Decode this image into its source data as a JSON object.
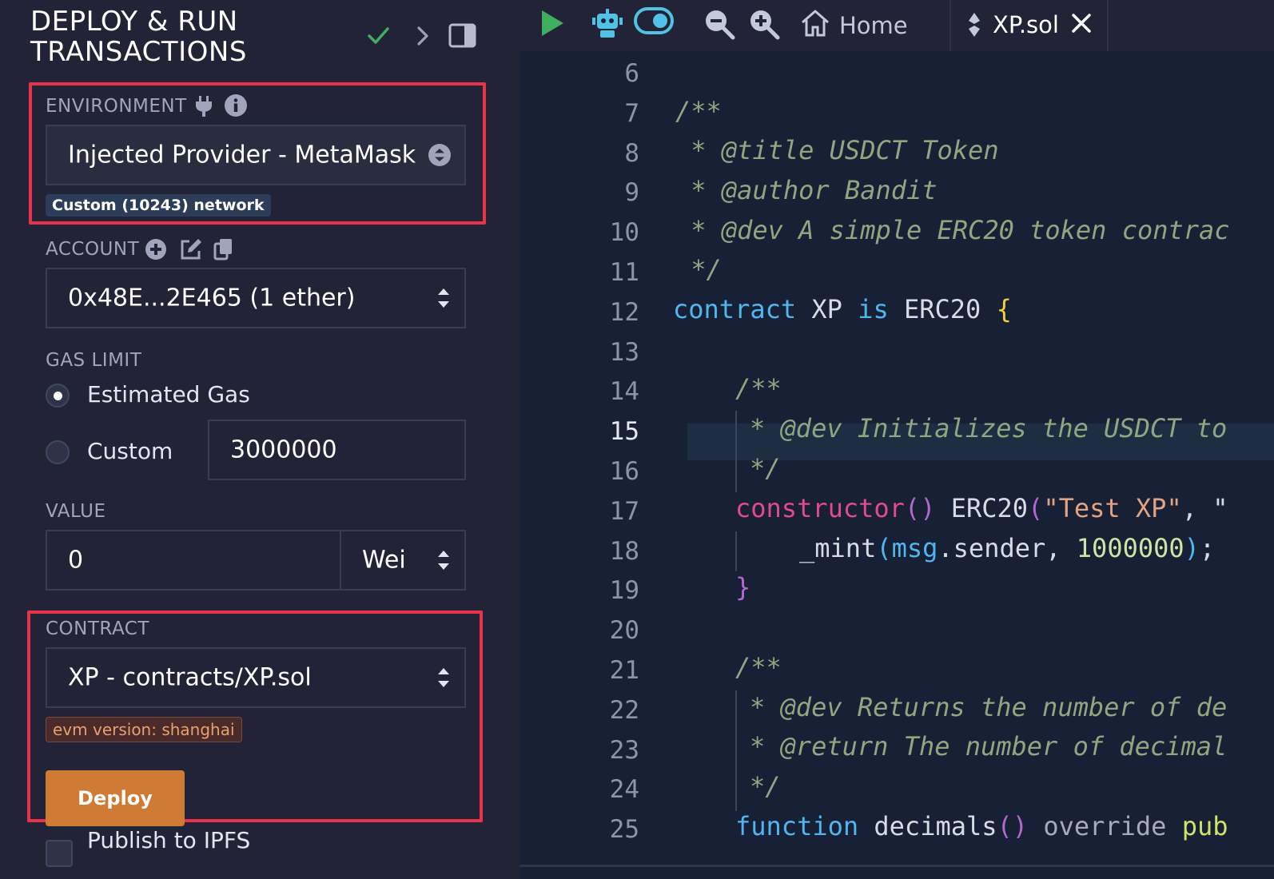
{
  "panel": {
    "title": "DEPLOY & RUN\nTRANSACTIONS",
    "environment": {
      "label": "ENVIRONMENT",
      "selected": "Injected Provider - MetaMask",
      "network_badge": "Custom (10243) network"
    },
    "account": {
      "label": "ACCOUNT",
      "selected": "0x48E...2E465 (1 ether)"
    },
    "gas_limit": {
      "label": "GAS LIMIT",
      "option_estimated": "Estimated Gas",
      "option_custom": "Custom",
      "custom_value": "3000000",
      "selected": "Estimated Gas"
    },
    "value": {
      "label": "VALUE",
      "amount": "0",
      "unit": "Wei"
    },
    "contract": {
      "label": "CONTRACT",
      "selected": "XP - contracts/XP.sol",
      "evm_badge": "evm version: shanghai",
      "deploy_label": "Deploy"
    },
    "publish_ipfs": "Publish to IPFS"
  },
  "topbar": {
    "home_tab": "Home",
    "file_tab": "XP.sol"
  },
  "editor": {
    "active_line": 15,
    "line_numbers": [
      "6",
      "7",
      "8",
      "9",
      "10",
      "11",
      "12",
      "13",
      "14",
      "15",
      "16",
      "17",
      "18",
      "19",
      "20",
      "21",
      "22",
      "23",
      "24",
      "25"
    ],
    "code": {
      "l7": "/**",
      "l8": " * @title USDCT Token",
      "l9": " * @author Bandit",
      "l10": " * @dev A simple ERC20 token contrac",
      "l11": " */",
      "l12_kw": "contract",
      "l12_name": " XP ",
      "l12_is": "is",
      "l12_base": " ERC20 ",
      "l12_brace": "{",
      "l14": "/**",
      "l15": "* @dev Initializes the USDCT to",
      "l16": "*/",
      "l17_ctor": "constructor",
      "l17_par": "()",
      "l17_call": " ERC20",
      "l17_open": "(",
      "l17_str": "\"Test XP\"",
      "l17_rest": ", \"",
      "l18_fn": "_mint",
      "l18_open": "(",
      "l18_msg": "msg",
      "l18_mid": ".sender, ",
      "l18_num": "1000000",
      "l18_close": ")",
      "l18_end": ";",
      "l19": "}",
      "l21": "/**",
      "l22": "* @dev Returns the number of de",
      "l23": "* @return The number of decimal",
      "l24": "*/",
      "l25_kw": "function",
      "l25_fn": " decimals",
      "l25_par": "()",
      "l25_mod": " override ",
      "l25_pub": "pub"
    }
  },
  "colors": {
    "panel_bg": "#222336",
    "editor_bg": "#172034",
    "highlight_border": "#e8344a",
    "deploy_button": "#cf7a35",
    "check": "#3fae5f"
  }
}
